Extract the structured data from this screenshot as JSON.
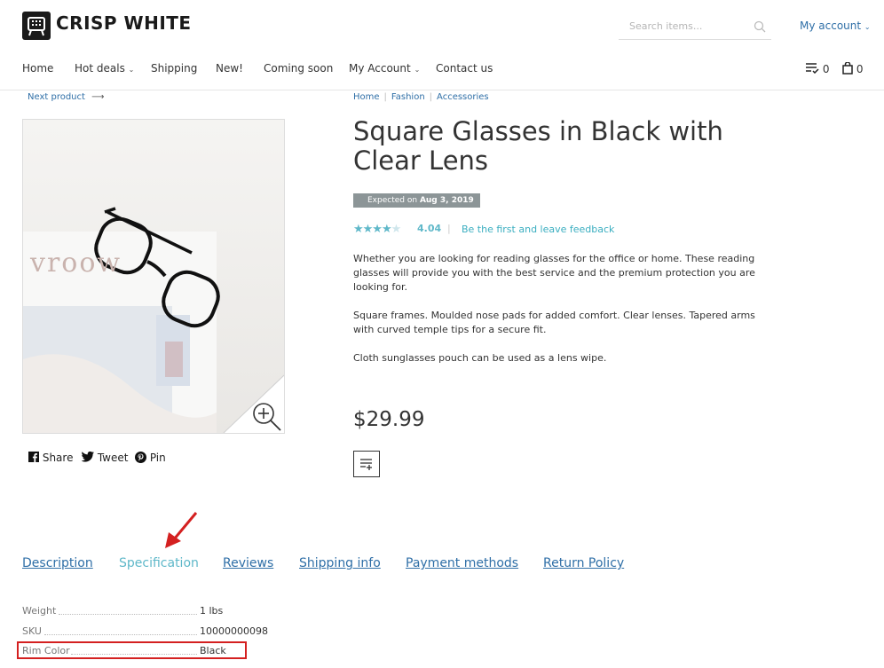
{
  "header": {
    "brand": "CRISP WHITE",
    "search_placeholder": "Search items...",
    "account_label": "My account",
    "wishlist_count": "0",
    "cart_count": "0"
  },
  "nav": [
    {
      "label": "Home"
    },
    {
      "label": "Hot deals"
    },
    {
      "label": "Shipping"
    },
    {
      "label": "New!"
    },
    {
      "label": "Coming soon"
    },
    {
      "label": "My Account"
    },
    {
      "label": "Contact us"
    }
  ],
  "product": {
    "next_label": "Next product",
    "breadcrumbs": [
      "Home",
      "Fashion",
      "Accessories"
    ],
    "title": "Square Glasses in Black with Clear Lens",
    "expected_prefix": "Expected on",
    "expected_date": "Aug 3, 2019",
    "rating": 4.04,
    "rating_text": "4.04",
    "feedback_link": "Be the first and leave feedback",
    "description": [
      "Whether you are looking for reading glasses for the office or home. These reading glasses will provide you with the best service and the premium protection you are looking for.",
      "Square frames. Moulded nose pads for added comfort. Clear lenses. Tapered arms with curved temple tips for a secure fit.",
      "Cloth sunglasses pouch can be used as a lens wipe."
    ],
    "image_text": "vroow",
    "price": "$29.99"
  },
  "share": {
    "facebook": "Share",
    "twitter": "Tweet",
    "pinterest": "Pin"
  },
  "tabs": [
    {
      "label": "Description"
    },
    {
      "label": "Specification"
    },
    {
      "label": "Reviews"
    },
    {
      "label": "Shipping info"
    },
    {
      "label": "Payment methods"
    },
    {
      "label": "Return Policy"
    }
  ],
  "active_tab": "Specification",
  "specs": [
    {
      "label": "Weight",
      "value": "1 lbs"
    },
    {
      "label": "SKU",
      "value": "10000000098"
    },
    {
      "label": "Rim Color",
      "value": "Black"
    }
  ],
  "colors": {
    "link": "#2f6fa7",
    "accent": "#5fb8c9",
    "annotation": "#d42020"
  }
}
